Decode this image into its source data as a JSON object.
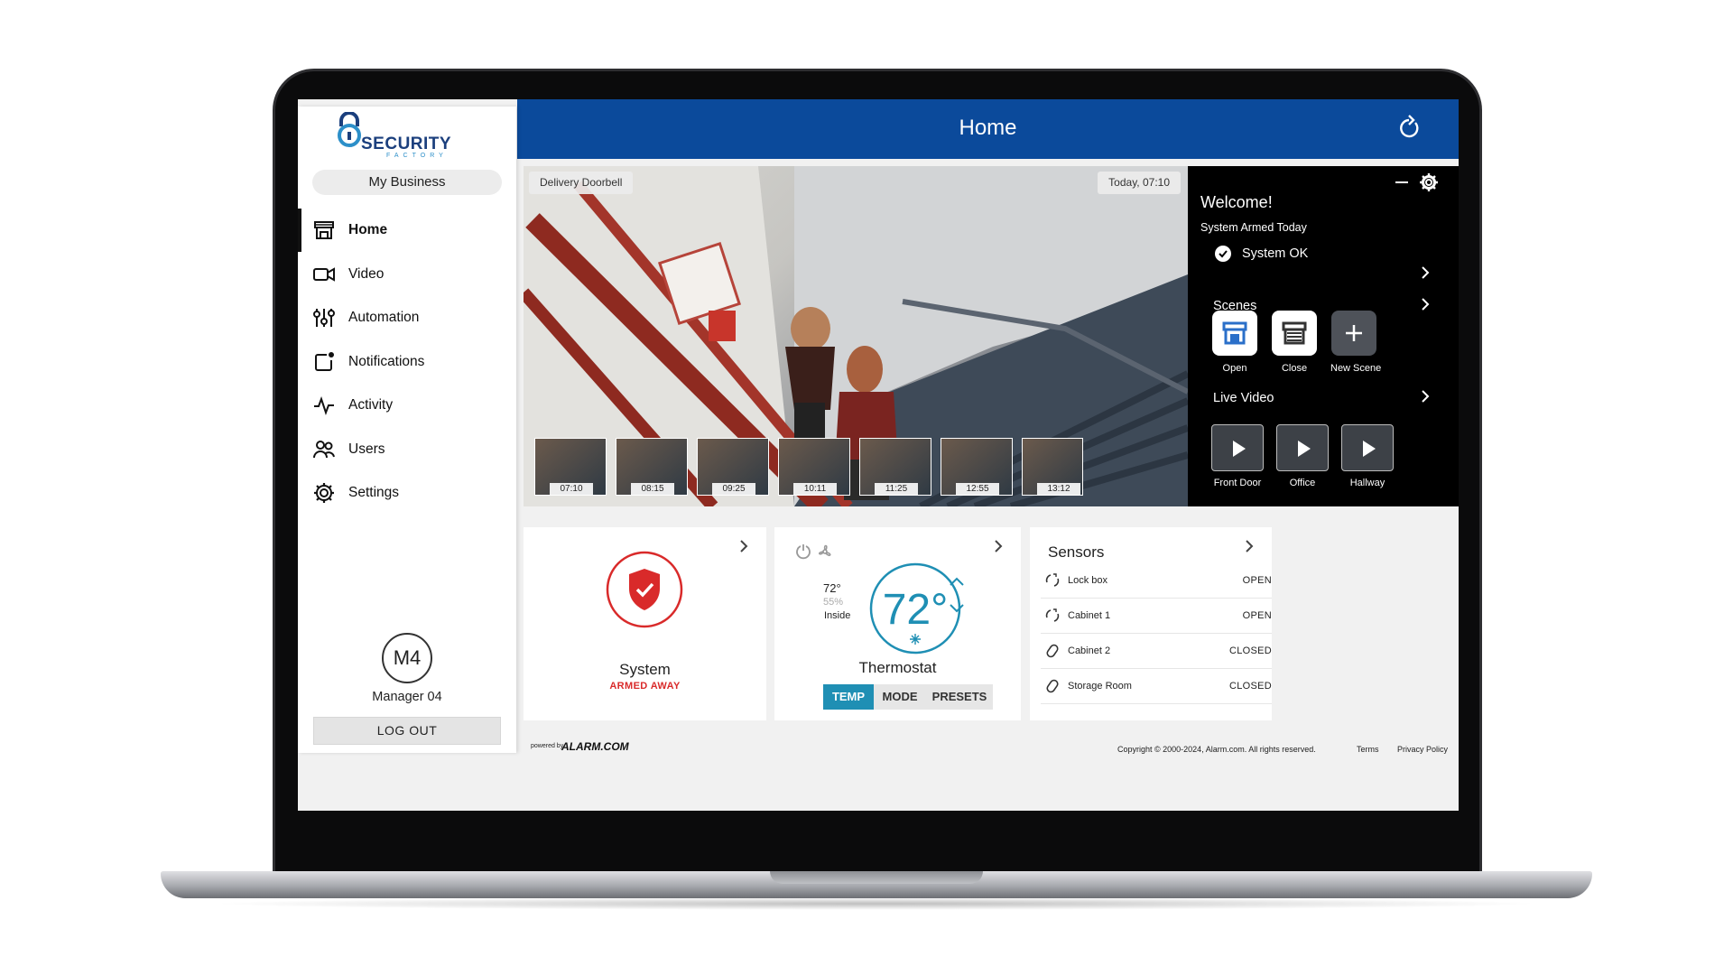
{
  "app": {
    "title": "Home",
    "brand": "SECURITY",
    "brand_sub": "FACTORY",
    "business": "My Business"
  },
  "sidebar": {
    "items": [
      {
        "label": "Home",
        "icon": "storefront-icon"
      },
      {
        "label": "Video",
        "icon": "video-camera-icon"
      },
      {
        "label": "Automation",
        "icon": "sliders-icon"
      },
      {
        "label": "Notifications",
        "icon": "notification-icon"
      },
      {
        "label": "Activity",
        "icon": "pulse-icon"
      },
      {
        "label": "Users",
        "icon": "users-icon"
      },
      {
        "label": "Settings",
        "icon": "gear-icon"
      }
    ],
    "avatar": "M4",
    "user": "Manager 04",
    "logout": "LOG OUT"
  },
  "camera": {
    "name": "Delivery Doorbell",
    "time": "Today, 07:10",
    "thumbs": [
      "07:10",
      "08:15",
      "09:25",
      "10:11",
      "11:25",
      "12:55",
      "13:12"
    ]
  },
  "welcome": {
    "title": "Welcome!",
    "sub": "System Armed Today",
    "status": "System OK",
    "scenes_label": "Scenes",
    "scenes": [
      {
        "label": "Open",
        "icon": "storefront-open-icon"
      },
      {
        "label": "Close",
        "icon": "storefront-closed-icon"
      },
      {
        "label": "New Scene",
        "icon": "plus-icon"
      }
    ],
    "live_label": "Live Video",
    "cameras": [
      "Front Door",
      "Office",
      "Hallway"
    ]
  },
  "system_card": {
    "name": "System",
    "status": "ARMED AWAY"
  },
  "thermostat": {
    "current": "72°",
    "inside_temp": "72°",
    "humidity": "55%",
    "inside_label": "Inside",
    "name": "Thermostat",
    "tabs": [
      "TEMP",
      "MODE",
      "PRESETS"
    ],
    "active_tab": "TEMP"
  },
  "sensors": {
    "title": "Sensors",
    "rows": [
      {
        "name": "Lock box",
        "state": "OPEN"
      },
      {
        "name": "Cabinet 1",
        "state": "OPEN"
      },
      {
        "name": "Cabinet 2",
        "state": "CLOSED"
      },
      {
        "name": "Storage Room",
        "state": "CLOSED"
      }
    ]
  },
  "footer": {
    "powered": "powered by",
    "alarm": "ALARM.COM",
    "copyright": "Copyright © 2000-2024, Alarm.com. All rights reserved.",
    "terms": "Terms",
    "privacy": "Privacy Policy"
  },
  "colors": {
    "header": "#0b4a9b",
    "accent": "#1f8fb4",
    "armed": "#d92a2a"
  }
}
